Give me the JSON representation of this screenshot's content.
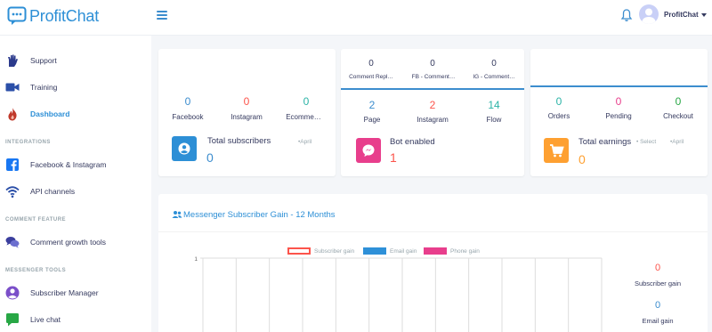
{
  "brand": {
    "name": "ProfitChat"
  },
  "header": {
    "user_name": "ProfitChat"
  },
  "sidebar": {
    "items": [
      {
        "label": "Support"
      },
      {
        "label": "Training"
      },
      {
        "label": "Dashboard"
      },
      {
        "label": "Facebook & Instagram"
      },
      {
        "label": "API channels"
      },
      {
        "label": "Comment growth tools"
      },
      {
        "label": "Subscriber Manager"
      },
      {
        "label": "Live chat"
      }
    ],
    "headings": {
      "integrations": "INTEGRATIONS",
      "comment": "COMMENT FEATURE",
      "messenger": "MESSENGER TOOLS"
    }
  },
  "card1": {
    "stats": [
      {
        "value": "0",
        "label": "Facebook",
        "color": "#3c8dce"
      },
      {
        "value": "0",
        "label": "Instagram",
        "color": "#fc544b"
      },
      {
        "value": "0",
        "label": "Ecomme…",
        "color": "#2bb3a6"
      }
    ],
    "title": "Total subscribers",
    "period": "•April",
    "value": "0"
  },
  "card2": {
    "top_stats": [
      {
        "value": "0",
        "label": "Comment Repl…"
      },
      {
        "value": "0",
        "label": "FB - Comment…"
      },
      {
        "value": "0",
        "label": "IG - Comment…"
      }
    ],
    "stats": [
      {
        "value": "2",
        "label": "Page",
        "color": "#3c8dce"
      },
      {
        "value": "2",
        "label": "Instagram",
        "color": "#fc544b"
      },
      {
        "value": "14",
        "label": "Flow",
        "color": "#2bb3a6"
      }
    ],
    "title": "Bot enabled",
    "value": "1"
  },
  "card3": {
    "stats": [
      {
        "value": "0",
        "label": "Orders",
        "color": "#2bb3a6"
      },
      {
        "value": "0",
        "label": "Pending",
        "color": "#e83e8c"
      },
      {
        "value": "0",
        "label": "Checkout",
        "color": "#28a745"
      }
    ],
    "title": "Total earnings",
    "select_label": "• Select",
    "period": "•April",
    "value": "0"
  },
  "chart_section": {
    "title": "Messenger Subscriber Gain - 12 Months",
    "stats": [
      {
        "value": "0",
        "label": "Subscriber gain",
        "color": "#fc544b"
      },
      {
        "value": "0",
        "label": "Email gain",
        "color": "#3c8dce"
      }
    ]
  },
  "chart_data": {
    "type": "bar",
    "title": "",
    "series": [
      {
        "name": "Subscriber gain",
        "color": "#fc544b"
      },
      {
        "name": "Email gain",
        "color": "#2e90d8"
      },
      {
        "name": "Phone gain",
        "color": "#e83e8c"
      }
    ],
    "ylim": [
      0,
      1
    ],
    "yticks": [
      "1"
    ],
    "grid": true
  },
  "colors": {
    "accent": "#2d8fd6",
    "blue_tile": "#2d8fd6",
    "pink_tile": "#e83e8c",
    "orange_tile": "#fea031"
  }
}
